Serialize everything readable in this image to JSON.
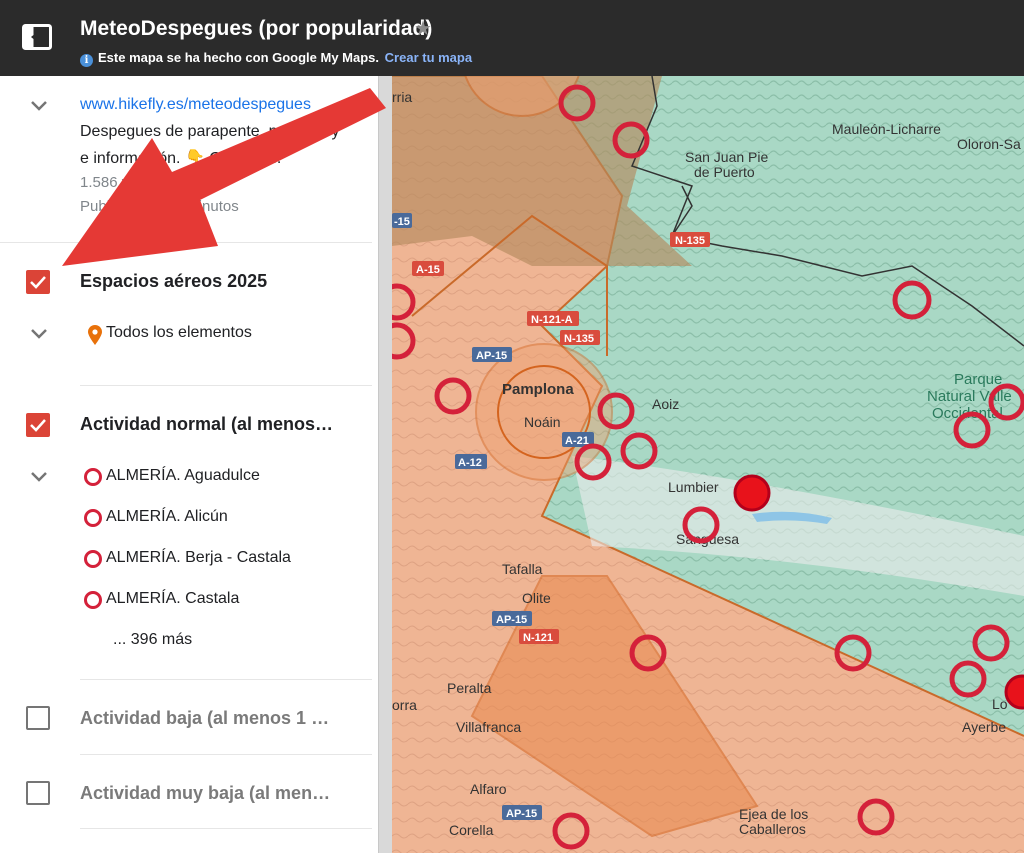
{
  "header": {
    "title": "MeteoDespegues (por popularidad)",
    "subtitle": "Este mapa se ha hecho con Google My Maps.",
    "create_link": "Crear tu mapa"
  },
  "panel": {
    "info": {
      "link": "www.hikefly.es/meteodespegues",
      "desc_line1": "Despegues de parapente, p",
      "desc_line1_tail": "y",
      "desc_line2": "e información. 👇 Cli",
      "desc_line2_tail": "...",
      "views": "1.586 vi",
      "published": "Publi",
      "published_tail": "19 minutos"
    },
    "layers": [
      {
        "title": "Espacios aéreos 2025",
        "checked": true,
        "items": [
          {
            "label": "Todos los elementos",
            "icon": "orange-pin-icon"
          }
        ]
      },
      {
        "title": "Actividad normal (al menos…",
        "checked": true,
        "items": [
          {
            "label": "ALMERÍA. Aguadulce",
            "icon": "red-ring-icon"
          },
          {
            "label": "ALMERÍA. Alicún",
            "icon": "red-ring-icon"
          },
          {
            "label": "ALMERÍA. Berja - Castala",
            "icon": "red-ring-icon"
          },
          {
            "label": "ALMERÍA. Castala",
            "icon": "red-ring-icon"
          }
        ],
        "more": "... 396 más"
      },
      {
        "title": "Actividad baja (al menos 1 …",
        "checked": false
      },
      {
        "title": "Actividad muy baja (al men…",
        "checked": false
      }
    ]
  },
  "map": {
    "labels": [
      "Mauleón-Licharre",
      "Oloron-Sa",
      "San Juan Pie",
      "de Puerto",
      "Pamplona",
      "Noáin",
      "Aoiz",
      "Lumbier",
      "Sangüesa",
      "Tafalla",
      "Olite",
      "Peralta",
      "Villafranca",
      "Alfaro",
      "Corella",
      "Ejea de los",
      "Caballeros",
      "Ayerbe",
      "Parque",
      "Natural Valle",
      "Occidental",
      "Lo",
      "orra",
      "rria"
    ],
    "roads": [
      "N-135",
      "A-15",
      "N-121-A",
      "N-135",
      "AP-15",
      "A-21",
      "A-12",
      "AP-15",
      "N-121",
      "AP-15",
      "-15"
    ]
  },
  "colors": {
    "header_bg": "#2b2b2b",
    "checkbox_on": "#db4437",
    "link": "#1a73e8",
    "marker_red": "#d4213a",
    "airspace_orange": "#e8a07a",
    "arrow_red": "#e53935"
  }
}
